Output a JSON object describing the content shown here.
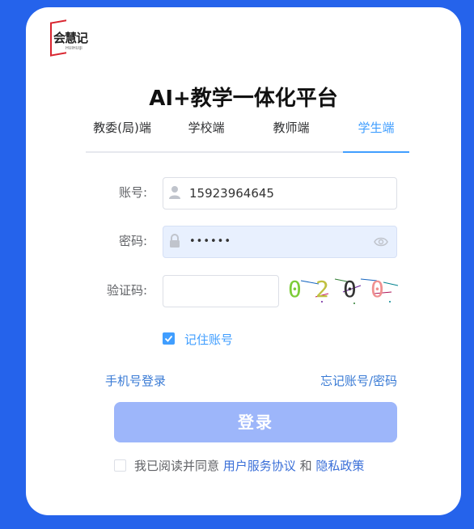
{
  "logo": {
    "text": "会慧记",
    "subtext": "HUIHUIJI"
  },
  "page": {
    "title": "AI+教学一体化平台"
  },
  "tabs": [
    {
      "label": "教委(局)端",
      "active": false
    },
    {
      "label": "学校端",
      "active": false
    },
    {
      "label": "教师端",
      "active": false
    },
    {
      "label": "学生端",
      "active": true
    }
  ],
  "form": {
    "account": {
      "label": "账号:",
      "value": "15923964645",
      "icon": "user-icon"
    },
    "password": {
      "label": "密码:",
      "value": "••••••",
      "icon": "lock-icon",
      "toggle_icon": "eye-icon"
    },
    "captcha": {
      "label": "验证码:",
      "value": "",
      "image_text": "0200"
    },
    "remember": {
      "label": "记住账号",
      "checked": true
    }
  },
  "links": {
    "phone_login": "手机号登录",
    "forgot": "忘记账号/密码"
  },
  "login_button": "登录",
  "agreement": {
    "prefix": "我已阅读并同意",
    "terms": "用户服务协议",
    "and": "和",
    "privacy": "隐私政策",
    "checked": false
  },
  "colors": {
    "background": "#2563eb",
    "accent": "#409eff",
    "button": "#9db6fa"
  }
}
